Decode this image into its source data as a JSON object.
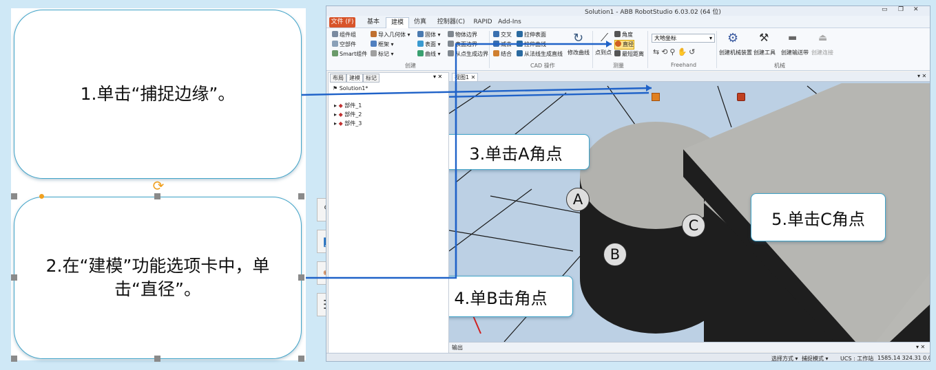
{
  "left_panel": {
    "callout1": "1.单击“捕捉边缘”。",
    "callout2": "2.在“建模”功能选项卡中，单击“直径”。"
  },
  "window": {
    "title": "Solution1 - ABB RobotStudio 6.03.02 (64 位)",
    "tabs": [
      "文件 (F)",
      "基本",
      "建模",
      "仿真",
      "控制器(C)",
      "RAPID",
      "Add-Ins"
    ]
  },
  "ribbon": {
    "create_group": [
      "组件组",
      "空部件",
      "Smart组件",
      "导入几何体",
      "框架",
      "标记",
      "固体",
      "表面",
      "曲线",
      "物体边界",
      "表面边界",
      "从点生成边界"
    ],
    "create_label": "创建",
    "cad_items": [
      "交叉",
      "减去",
      "结合",
      "拉伸表面",
      "拉伸曲线",
      "从法线生成直线",
      "修改曲线"
    ],
    "cad_label": "CAD 操作",
    "measure_items": [
      "点到点",
      "角度",
      "直径",
      "最短距离"
    ],
    "measure_label": "测量",
    "freehand_select": "大地坐标",
    "freehand_label": "Freehand",
    "mechanism_items": [
      "创建机械装置",
      "创建工具",
      "创建输送带",
      "创建连接"
    ],
    "mechanism_label": "机械"
  },
  "layout_panel": {
    "tabs": [
      "布局",
      "建模",
      "标记"
    ],
    "tree": [
      "Solution1*",
      "部件_1",
      "部件_2",
      "部件_3"
    ]
  },
  "viewport": {
    "tab_label": "视图1",
    "points": [
      "A",
      "B",
      "C"
    ],
    "bubble3": "3.单击A角点",
    "bubble4": "4.单B击角点",
    "bubble5": "5.单击C角点"
  },
  "output": {
    "label": "输出"
  },
  "status": {
    "select_mode": "选择方式",
    "snap_mode": "捕捉模式",
    "ucs": "UCS : 工作站",
    "coords": "1585.14  324.31  0.00"
  }
}
